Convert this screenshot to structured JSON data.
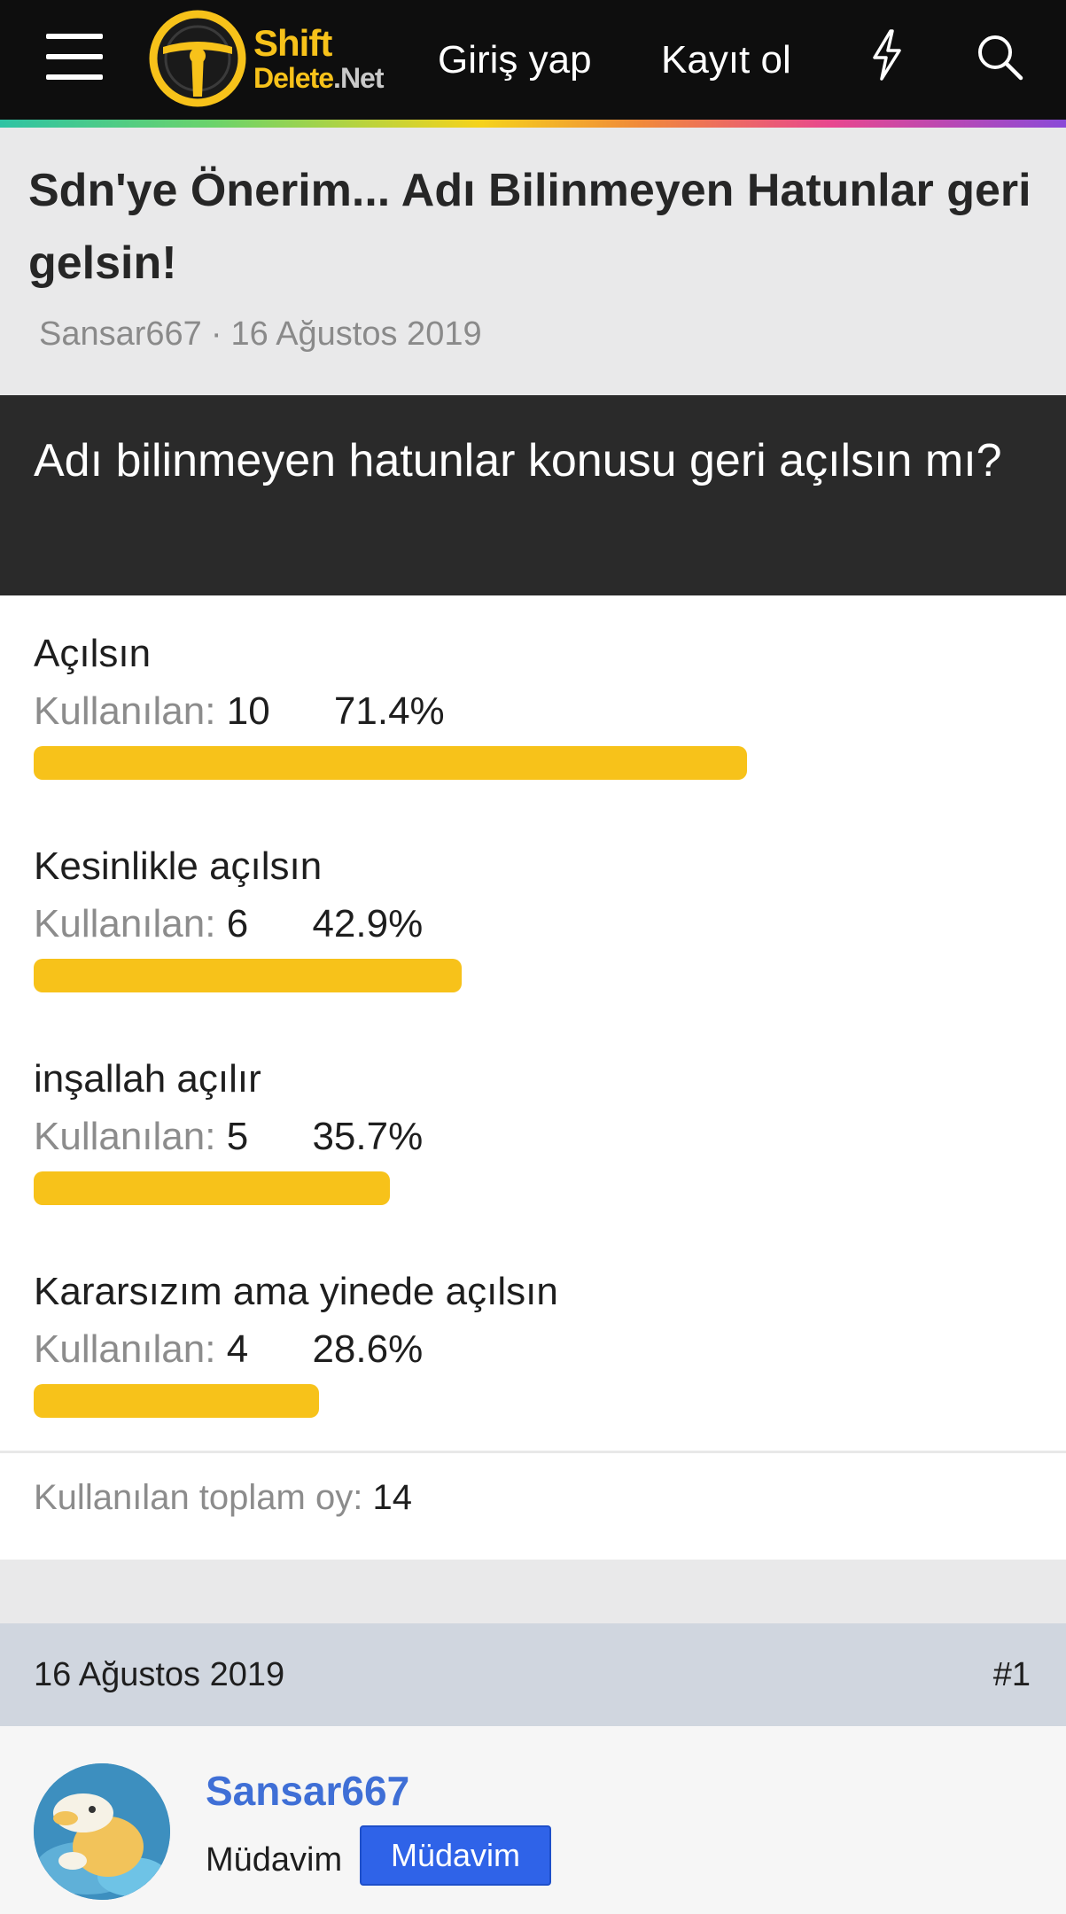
{
  "header": {
    "logo": {
      "line1": "Shift",
      "line2a": "Delete",
      "line2b": ".Net"
    },
    "login_label": "Giriş yap",
    "register_label": "Kayıt ol",
    "icons": [
      "menu-icon",
      "bolt-icon",
      "search-icon"
    ]
  },
  "thread": {
    "title": "Sdn'ye Önerim... Adı Bilinmeyen Hatunlar geri gelsin!",
    "author": "Sansar667",
    "separator": "·",
    "date": "16 Ağustos 2019"
  },
  "poll": {
    "question": " Adı bilinmeyen hatunlar konusu geri açılsın mı?",
    "used_label": "Kullanılan:",
    "options": [
      {
        "label": "Açılsın",
        "votes": "10",
        "percent": "71.4%",
        "fill": 0.714
      },
      {
        "label": "Kesinlikle açılsın",
        "votes": "6",
        "percent": "42.9%",
        "fill": 0.429
      },
      {
        "label": "inşallah açılır",
        "votes": "5",
        "percent": "35.7%",
        "fill": 0.357
      },
      {
        "label": "Kararsızım ama yinede açılsın",
        "votes": "4",
        "percent": "28.6%",
        "fill": 0.286
      }
    ],
    "total_label": "Kullanılan toplam oy:",
    "total_value": "14"
  },
  "post": {
    "date": "16 Ağustos 2019",
    "number": "#1",
    "username": "Sansar667",
    "user_title": "Müdavim",
    "badge": "Müdavim"
  },
  "colors": {
    "header_bg": "#0e0e0e",
    "accent_yellow": "#f7c21a",
    "poll_head_bg": "#2a2a2a",
    "username_blue": "#3f6fd6",
    "badge_blue": "#2f63e8",
    "post_header_bg": "#d0d6df"
  }
}
